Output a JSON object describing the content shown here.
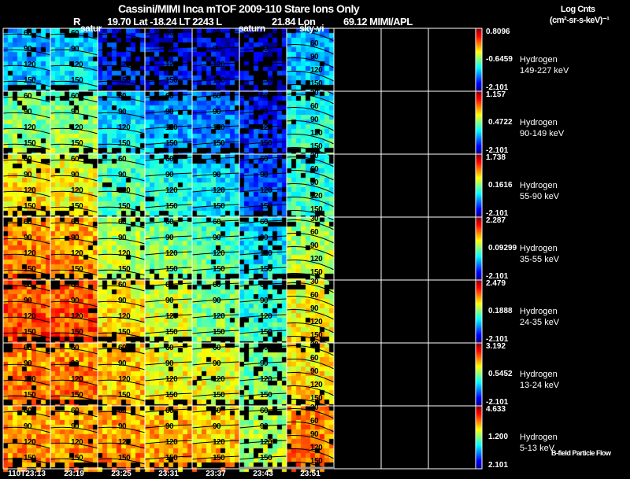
{
  "header": {
    "title": "Cassini/MIMI Inca mTOF  2009-110   Stare   Ions Only",
    "ephemeris": [
      {
        "label": "R",
        "value": ""
      },
      {
        "label": "",
        "value": "19.70 Lat -18.24 LT 2243 L"
      },
      {
        "label": "",
        "value": "21.84 Lon"
      },
      {
        "label": "",
        "value": "69.12  MIMI/APL"
      }
    ],
    "units_line1": "Log Cnts",
    "units_line2": "(cm²-sr-s-keV)⁻¹"
  },
  "overlays": [
    "satur",
    "saturn",
    "sky-vi"
  ],
  "footer_note": "B-field Particle Flow",
  "colors": {
    "background": "#000000",
    "grid": "#ffffff",
    "contour": "#000000"
  },
  "chart_data": {
    "type": "heatmap",
    "title": "Cassini/MIMI Inca mTOF  2009-110   Stare   Ions Only",
    "time_labels": [
      "110T23:13",
      "23:19",
      "23:25",
      "23:31",
      "23:37",
      "23:43",
      "23:51"
    ],
    "empty_columns": 3,
    "contour_labels": [
      "60",
      "90",
      "120",
      "150"
    ],
    "contour_labels_last_column": [
      "30",
      "60",
      "90",
      "120",
      "150"
    ],
    "channels": [
      {
        "species": "Hydrogen",
        "energy": "149-227 keV",
        "max": "0.8096",
        "mid": "-0.6459",
        "min": "-2.101",
        "panel_levels": [
          0.3,
          0.35,
          0.15,
          0.13,
          0.12,
          0.1,
          0.3
        ]
      },
      {
        "species": "Hydrogen",
        "energy": "90-149 keV",
        "max": "1.157",
        "mid": "0.4722",
        "min": "-2.101",
        "panel_levels": [
          0.5,
          0.52,
          0.35,
          0.28,
          0.25,
          0.15,
          0.4
        ]
      },
      {
        "species": "Hydrogen",
        "energy": "55-90 keV",
        "max": "1.738",
        "mid": "0.1616",
        "min": "-2.101",
        "panel_levels": [
          0.65,
          0.62,
          0.45,
          0.4,
          0.35,
          0.2,
          0.42
        ]
      },
      {
        "species": "Hydrogen",
        "energy": "35-55 keV",
        "max": "2.287",
        "mid": "0.09299",
        "min": "-2.101",
        "panel_levels": [
          0.75,
          0.72,
          0.55,
          0.5,
          0.45,
          0.35,
          0.55
        ]
      },
      {
        "species": "Hydrogen",
        "energy": "24-35 keV",
        "max": "2.479",
        "mid": "0.1888",
        "min": "-2.101",
        "panel_levels": [
          0.8,
          0.8,
          0.65,
          0.58,
          0.5,
          0.42,
          0.62
        ]
      },
      {
        "species": "Hydrogen",
        "energy": "13-24 keV",
        "max": "3.192",
        "mid": "0.5452",
        "min": "-2.101",
        "panel_levels": [
          0.75,
          0.75,
          0.68,
          0.62,
          0.6,
          0.5,
          0.65
        ]
      },
      {
        "species": "Hydrogen",
        "energy": "5-13 keV",
        "max": "4.633",
        "mid": "1.200",
        "min": "2.101",
        "panel_levels": [
          0.72,
          0.72,
          0.72,
          0.7,
          0.68,
          0.55,
          0.75
        ]
      }
    ]
  }
}
